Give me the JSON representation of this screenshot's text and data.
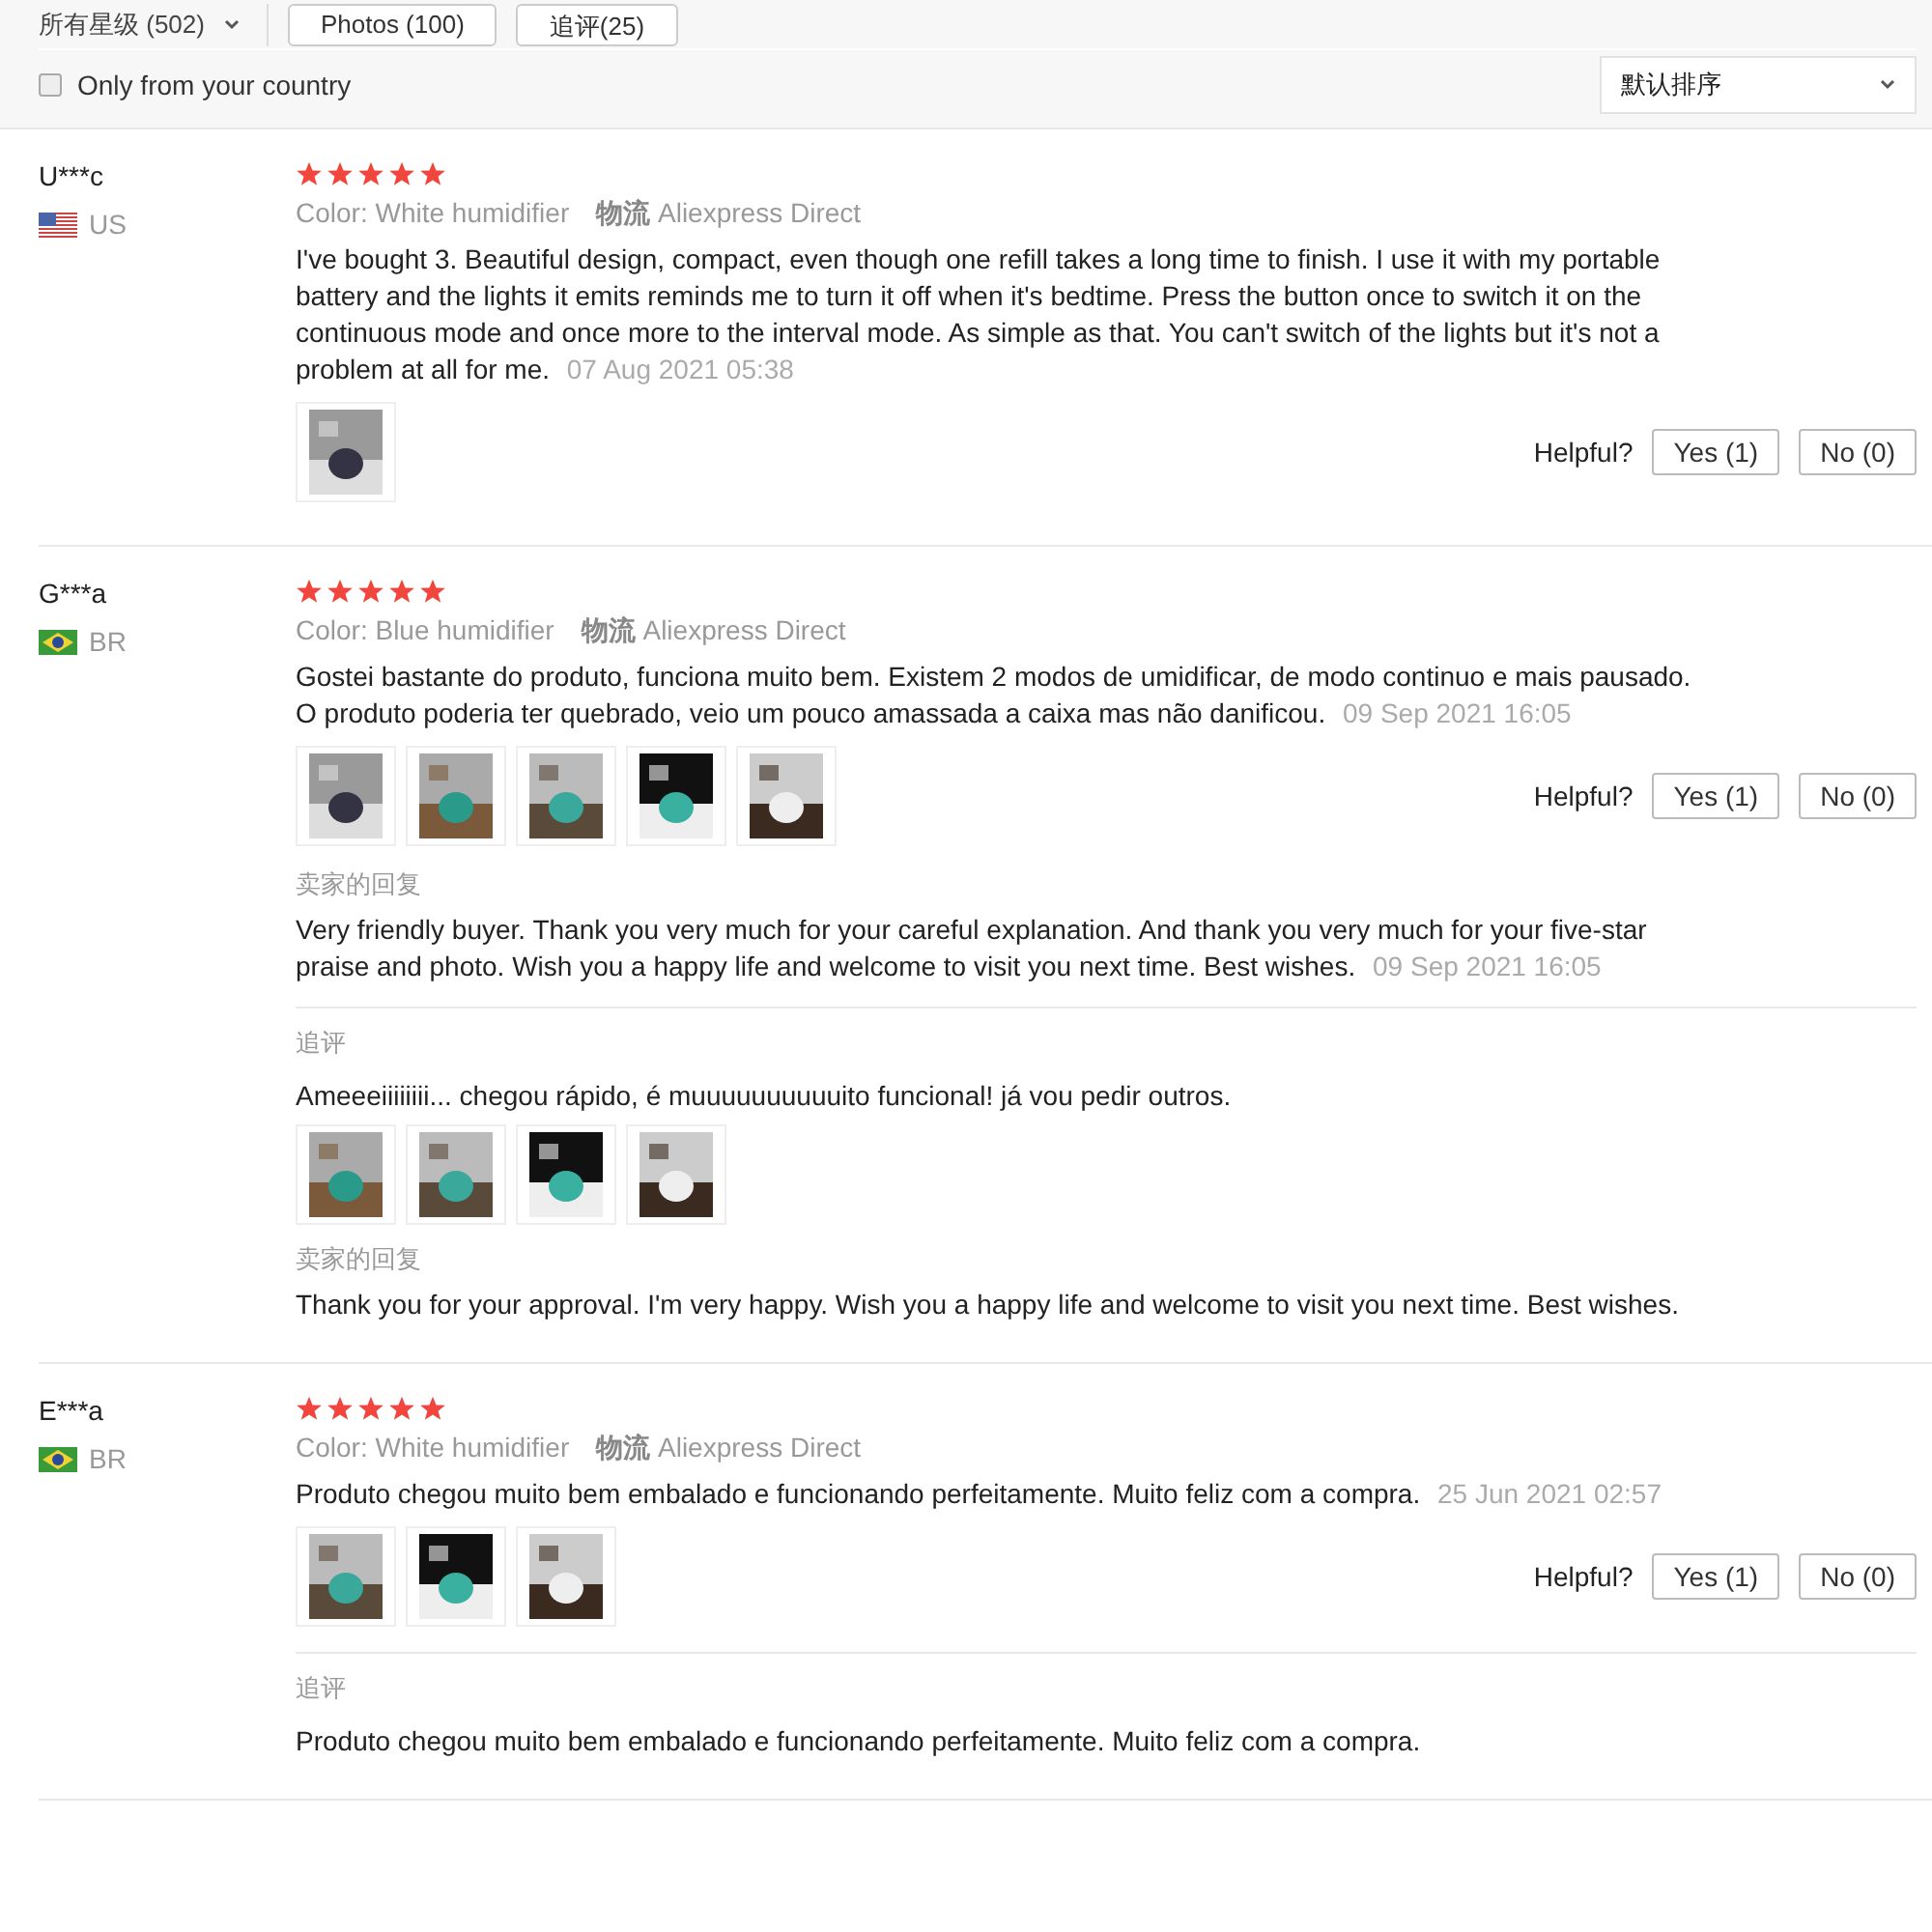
{
  "filters": {
    "rating_dropdown": "所有星级 (502)",
    "tabs": [
      {
        "label": "Photos (100)",
        "selected": false
      },
      {
        "label": "追评(25)",
        "selected": false
      }
    ],
    "country_checkbox": {
      "label": "Only from your country",
      "checked": false
    },
    "sort_dropdown": "默认排序"
  },
  "reviews": [
    {
      "name": "U***c",
      "country_flag": {
        "kind": "us"
      },
      "country": "US",
      "stars": 5,
      "variant": "Color: White humidifier",
      "logistics_label": "物流",
      "logistics": "Aliexpress Direct",
      "text": "I've bought 3. Beautiful design, compact, even though one refill takes a long time to finish. I use it with my portable battery and the lights it emits reminds me to turn it off when it's bedtime. Press the button once to switch it on the continuous mode and once more to the interval mode. As simple as that. You can't switch of the lights but it's not a problem at all for me.",
      "date": "07 Aug 2021 05:38",
      "photos": [
        {
          "kind": "picture"
        }
      ],
      "helpful": "Helpful?",
      "yes": "Yes (1)",
      "no": "No (0)"
    },
    {
      "name": "G***a",
      "country_flag": {
        "kind": "br"
      },
      "country": "BR",
      "stars": 5,
      "variant": "Color: Blue humidifier",
      "logistics_label": "物流",
      "logistics": "Aliexpress Direct",
      "text": "Gostei bastante do produto, funciona muito bem. Existem 2 modos de umidificar, de modo continuo e mais pausado. O produto poderia ter quebrado, veio um pouco amassada a caixa mas não danificou.",
      "date": "09 Sep 2021 16:05",
      "photos": [
        {
          "kind": "picture"
        },
        {
          "kind": "picture"
        },
        {
          "kind": "picture"
        },
        {
          "kind": "picture"
        },
        {
          "kind": "picture"
        }
      ],
      "helpful": "Helpful?",
      "yes": "Yes (1)",
      "no": "No (0)",
      "seller_reply": {
        "label": "卖家的回复",
        "text": "Very friendly buyer. Thank you very much for your careful explanation. And thank you very much for your five-star praise and photo. Wish you a happy life and welcome to visit you next time. Best wishes.",
        "date": "09 Sep 2021 16:05"
      },
      "followup": {
        "label": "追评",
        "text": "Ameeeiiiiiiii... chegou rápido, é muuuuuuuuuuito funcional! já vou pedir outros.",
        "photos": [
          {
            "kind": "picture"
          },
          {
            "kind": "picture"
          },
          {
            "kind": "picture"
          },
          {
            "kind": "picture"
          }
        ],
        "seller_reply": {
          "label": "卖家的回复",
          "text": "Thank you for your approval. I'm very happy. Wish you a happy life and welcome to visit you next time. Best wishes."
        }
      }
    },
    {
      "name": "E***a",
      "country_flag": {
        "kind": "br"
      },
      "country": "BR",
      "stars": 5,
      "variant": "Color: White humidifier",
      "logistics_label": "物流",
      "logistics": "Aliexpress Direct",
      "text": "Produto chegou muito bem embalado e funcionando perfeitamente. Muito feliz com a compra.",
      "date": "25 Jun 2021 02:57",
      "photos": [
        {
          "kind": "picture"
        },
        {
          "kind": "picture"
        },
        {
          "kind": "picture"
        }
      ],
      "helpful": "Helpful?",
      "yes": "Yes (1)",
      "no": "No (0)",
      "followup": {
        "label": "追评",
        "text": "Produto chegou muito bem embalado e funcionando perfeitamente. Muito feliz com a compra."
      }
    }
  ]
}
